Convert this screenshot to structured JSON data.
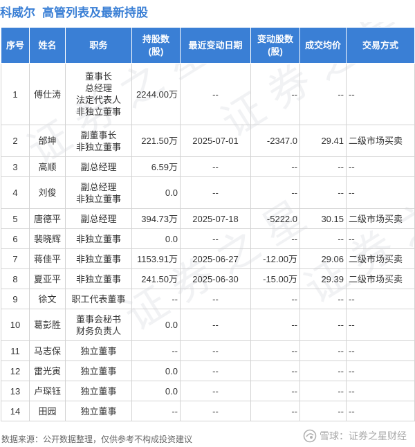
{
  "title": {
    "company": "科威尔",
    "heading": "高管列表及最新持股"
  },
  "table": {
    "headers": {
      "seq": "序号",
      "name": "姓名",
      "position": "职务",
      "holding_line1": "持股数",
      "holding_line2": "(股)",
      "date": "最近变动日期",
      "change_line1": "变动股数",
      "change_line2": "(股)",
      "price": "成交均价",
      "mode": "交易方式"
    },
    "rows": [
      {
        "seq": "1",
        "name": "傅仕涛",
        "positions": [
          "董事长",
          "总经理",
          "法定代表人",
          "非独立董事"
        ],
        "holding": "2244.00万",
        "date": "--",
        "change": "--",
        "price": "--",
        "mode": "--"
      },
      {
        "seq": "2",
        "name": "邰坤",
        "positions": [
          "副董事长",
          "非独立董事"
        ],
        "holding": "221.50万",
        "date": "2025-07-01",
        "change": "-2347.0",
        "price": "29.41",
        "mode": "二级市场买卖"
      },
      {
        "seq": "3",
        "name": "高顺",
        "positions": [
          "副总经理"
        ],
        "holding": "6.59万",
        "date": "--",
        "change": "--",
        "price": "--",
        "mode": "--"
      },
      {
        "seq": "4",
        "name": "刘俊",
        "positions": [
          "副总经理",
          "非独立董事"
        ],
        "holding": "0.0",
        "date": "--",
        "change": "--",
        "price": "--",
        "mode": "--"
      },
      {
        "seq": "5",
        "name": "唐德平",
        "positions": [
          "副总经理"
        ],
        "holding": "394.73万",
        "date": "2025-07-18",
        "change": "-5222.0",
        "price": "30.15",
        "mode": "二级市场买卖"
      },
      {
        "seq": "6",
        "name": "裴晓辉",
        "positions": [
          "非独立董事"
        ],
        "holding": "0.0",
        "date": "--",
        "change": "--",
        "price": "--",
        "mode": "--"
      },
      {
        "seq": "7",
        "name": "蒋佳平",
        "positions": [
          "非独立董事"
        ],
        "holding": "1153.91万",
        "date": "2025-06-27",
        "change": "-12.00万",
        "price": "29.06",
        "mode": "二级市场买卖"
      },
      {
        "seq": "8",
        "name": "夏亚平",
        "positions": [
          "非独立董事"
        ],
        "holding": "241.50万",
        "date": "2025-06-30",
        "change": "-15.00万",
        "price": "29.39",
        "mode": "二级市场买卖"
      },
      {
        "seq": "9",
        "name": "徐文",
        "positions": [
          "职工代表董事"
        ],
        "holding": "--",
        "date": "--",
        "change": "--",
        "price": "--",
        "mode": "--"
      },
      {
        "seq": "10",
        "name": "葛彭胜",
        "positions": [
          "董事会秘书",
          "财务负责人"
        ],
        "holding": "0.0",
        "date": "--",
        "change": "--",
        "price": "--",
        "mode": "--"
      },
      {
        "seq": "11",
        "name": "马志保",
        "positions": [
          "独立董事"
        ],
        "holding": "--",
        "date": "--",
        "change": "--",
        "price": "--",
        "mode": "--"
      },
      {
        "seq": "12",
        "name": "雷光寅",
        "positions": [
          "独立董事"
        ],
        "holding": "0.0",
        "date": "--",
        "change": "--",
        "price": "--",
        "mode": "--"
      },
      {
        "seq": "13",
        "name": "卢琛钰",
        "positions": [
          "独立董事"
        ],
        "holding": "0.0",
        "date": "--",
        "change": "--",
        "price": "--",
        "mode": "--"
      },
      {
        "seq": "14",
        "name": "田园",
        "positions": [
          "独立董事"
        ],
        "holding": "--",
        "date": "--",
        "change": "--",
        "price": "--",
        "mode": "--"
      }
    ]
  },
  "footer": {
    "source": "数据来源：公开数据整理，仅供参考不构成投资建议",
    "brand": "雪球：证券之星财经",
    "brand_icon": "snowball-icon"
  },
  "watermark": [
    "证",
    "券",
    "之",
    "星"
  ],
  "colors": {
    "header_bg": "#3a7fd5",
    "title": "#3a7fd5",
    "negative_change": "#2fa13a"
  }
}
